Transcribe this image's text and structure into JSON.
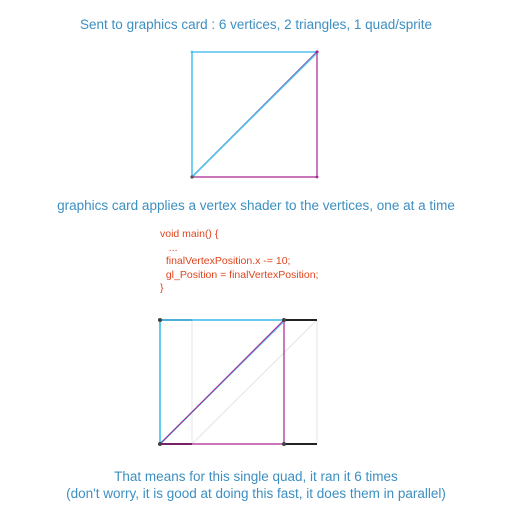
{
  "captions": {
    "top": "Sent to graphics card : 6 vertices, 2 triangles, 1 quad/sprite",
    "middle": "graphics card applies a vertex shader to the vertices, one at a time",
    "bottom_line1": "That means for this single quad, it ran it 6 times",
    "bottom_line2": "(don't worry, it is good at doing this fast, it does them in parallel)"
  },
  "code": {
    "lines": [
      "void main() {",
      "   ...",
      "  finalVertexPosition.x -= 10;",
      "  gl_Position = finalVertexPosition;",
      "}"
    ]
  },
  "colors": {
    "caption": "#3d8fc2",
    "code": "#e0451f",
    "triangle_a": "#55c3ef",
    "triangle_b": "#a8238f",
    "ghost": "#e4e4e4",
    "vertex_offset": "#222222"
  }
}
